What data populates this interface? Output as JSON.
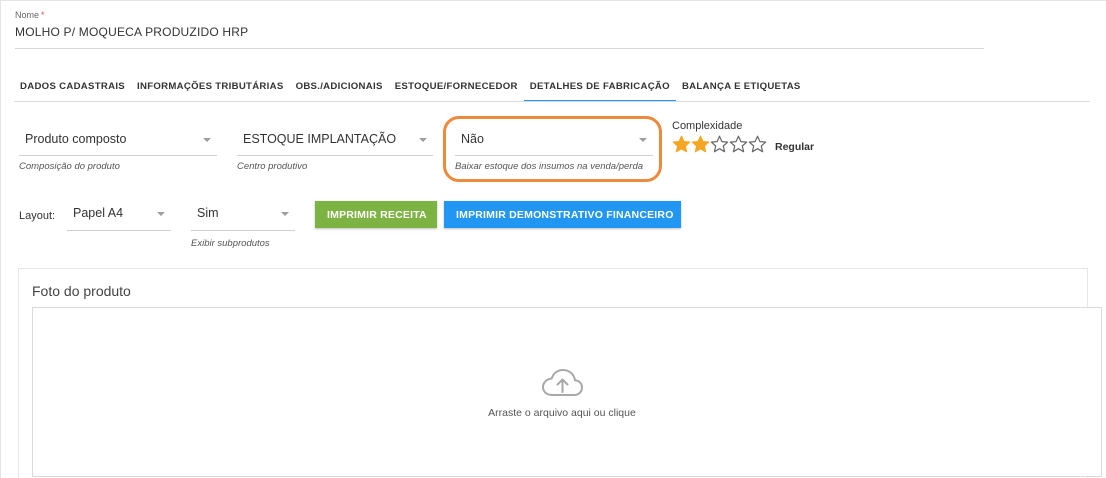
{
  "nome": {
    "label": "Nome",
    "required_mark": "*",
    "value": "MOLHO P/ MOQUECA PRODUZIDO HRP"
  },
  "tabs": [
    {
      "label": "DADOS CADASTRAIS",
      "active": false
    },
    {
      "label": "INFORMAÇÕES TRIBUTÁRIAS",
      "active": false
    },
    {
      "label": "OBS./ADICIONAIS",
      "active": false
    },
    {
      "label": "ESTOQUE/FORNECEDOR",
      "active": false
    },
    {
      "label": "DETALHES DE FABRICAÇÃO",
      "active": true
    },
    {
      "label": "BALANÇA E ETIQUETAS",
      "active": false
    }
  ],
  "fields": {
    "composicao": {
      "value": "Produto composto",
      "hint": "Composição do produto"
    },
    "centro": {
      "value": "ESTOQUE IMPLANTAÇÃO",
      "hint": "Centro produtivo"
    },
    "baixar": {
      "value": "Não",
      "hint": "Baixar estoque dos insumos na venda/perda"
    }
  },
  "complexidade": {
    "label": "Complexidade",
    "rating": 2,
    "max": 5,
    "value_label": "Regular",
    "star_color": "#f5a623"
  },
  "layout": {
    "label": "Layout:",
    "papel": {
      "value": "Papel A4"
    },
    "subprodutos": {
      "value": "Sim",
      "hint": "Exibir subprodutos"
    }
  },
  "buttons": {
    "imprimir_receita": "IMPRIMIR RECEITA",
    "imprimir_demonstrativo": "IMPRIMIR DEMONSTRATIVO FINANCEIRO"
  },
  "foto": {
    "title": "Foto do produto",
    "drop_text": "Arraste o arquivo aqui ou clique",
    "icon": "cloud-upload-icon"
  },
  "colors": {
    "accent_blue": "#2196f3",
    "button_green": "#7cb342",
    "highlight_orange": "#ef8a3c"
  }
}
